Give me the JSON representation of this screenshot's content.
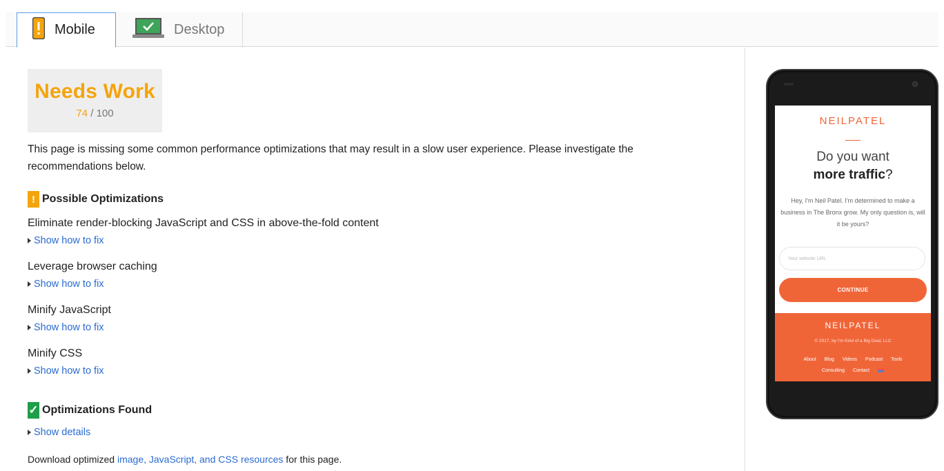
{
  "tabs": {
    "mobile": {
      "label": "Mobile",
      "icon": "mobile-warning-icon"
    },
    "desktop": {
      "label": "Desktop",
      "icon": "laptop-check-icon"
    }
  },
  "score": {
    "verdict": "Needs Work",
    "value": "74",
    "max": "/ 100",
    "color": "#f4a40c"
  },
  "summary": "This page is missing some common performance optimizations that may result in a slow user experience. Please investigate the recommendations below.",
  "possible": {
    "badge": "!",
    "heading": "Possible Optimizations",
    "fix_label": "Show how to fix",
    "rules": [
      "Eliminate render-blocking JavaScript and CSS in above-the-fold content",
      "Leverage browser caching",
      "Minify JavaScript",
      "Minify CSS"
    ]
  },
  "found": {
    "badge": "✓",
    "heading": "Optimizations Found",
    "details_label": "Show details"
  },
  "footer": {
    "prefix": "Download optimized ",
    "link": "image, JavaScript, and CSS resources",
    "suffix": " for this page."
  },
  "preview": {
    "logo": "NEILPATEL",
    "head1": "Do you want",
    "head2_bold": "more traffic",
    "head2_tail": "?",
    "text": "Hey, I'm Neil Patel. I'm determined to make a business in The Bronx grow. My only question is, will it be yours?",
    "input_placeholder": "Your website URL",
    "button": "CONTINUE",
    "footer_logo": "NEILPATEL",
    "copyright": "© 2017, by I'm Kind of a Big Deal, LLC",
    "links_row1": [
      "About",
      "Blog",
      "Videos",
      "Podcast",
      "Tools"
    ],
    "links_row2": [
      "Consulting",
      "Contact"
    ]
  },
  "colors": {
    "warning": "#f4a40c",
    "success": "#1e9e48",
    "link": "#2a6bd1",
    "brand": "#f06538"
  }
}
